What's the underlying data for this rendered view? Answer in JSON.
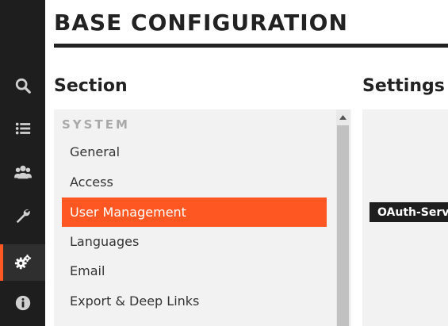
{
  "header": {
    "title": "BASE CONFIGURATION"
  },
  "rail": {
    "items": [
      {
        "icon": "search-icon"
      },
      {
        "icon": "list-icon"
      },
      {
        "icon": "users-icon"
      },
      {
        "icon": "wrench-icon"
      },
      {
        "icon": "gears-icon",
        "active": true
      },
      {
        "icon": "info-icon"
      }
    ]
  },
  "section": {
    "heading": "Section",
    "group": "SYSTEM",
    "items": [
      {
        "label": "General"
      },
      {
        "label": "Access"
      },
      {
        "label": "User Management",
        "selected": true
      },
      {
        "label": "Languages"
      },
      {
        "label": "Email"
      },
      {
        "label": "Export & Deep Links"
      }
    ]
  },
  "settings": {
    "heading": "Settings",
    "row_label": "OAuth-Serv"
  },
  "colors": {
    "accent": "#ff5722",
    "rail_bg": "#1e1e1e",
    "panel_bg": "#f2f2f2"
  }
}
